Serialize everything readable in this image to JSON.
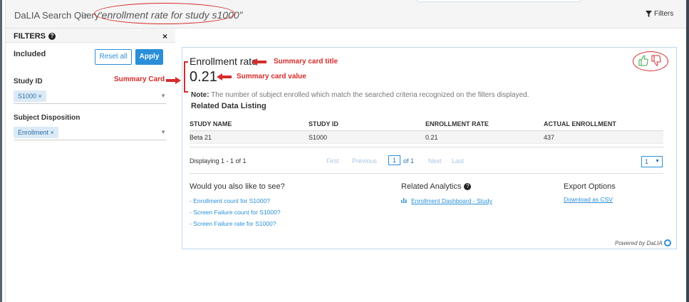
{
  "header": {
    "app_title": "DaLIA Search Query",
    "separator": ">",
    "query": "“enrollment rate for study s1000”",
    "filters_button": "Filters"
  },
  "filters_panel": {
    "title": "FILTERS",
    "close": "×",
    "included_label": "Included",
    "reset_label": "Reset all",
    "apply_label": "Apply",
    "study_id": {
      "label": "Study ID",
      "chip": "S1000 ×"
    },
    "subject_disposition": {
      "label": "Subject Disposition",
      "chip": "Enrollment ×"
    }
  },
  "annotations": {
    "summary_card": "Summary Card",
    "summary_card_title": "Summary card title",
    "summary_card_value": "Summary card value"
  },
  "card": {
    "title": "Enrollment rate",
    "value": "0.21",
    "note_label": "Note:",
    "note_text": " The number of subject enrolled which match the searched criteria recognized on the filters displayed.",
    "listing_title": "Related Data Listing",
    "columns": [
      "STUDY NAME",
      "STUDY ID",
      "ENROLLMENT RATE",
      "ACTUAL ENROLLMENT"
    ],
    "rows": [
      [
        "Beta 21",
        "S1000",
        "0.21",
        "437"
      ]
    ],
    "pager": {
      "displaying": "Displaying 1 - 1 of 1",
      "first": "First",
      "previous": "Previous",
      "page": "1",
      "of": "of 1",
      "next": "Next",
      "last": "Last",
      "page_size": "1"
    },
    "suggestions_title": "Would you also like to see?",
    "suggestions": [
      "- Enrollment count for S1000?",
      "- Screen Failure count for S1000?",
      "- Screen Failure rate for S1000?"
    ],
    "related_analytics_title": "Related Analytics",
    "related_analytics_link": "Enrollment Dashboard - Study",
    "export_title": "Export Options",
    "export_link": "Download as CSV",
    "powered_by": "Powered by DaLIA"
  },
  "colors": {
    "accent": "#2a8fd8",
    "annotation": "#d62b2b",
    "thumb_up": "#3aa84a",
    "thumb_down": "#d62b2b"
  }
}
